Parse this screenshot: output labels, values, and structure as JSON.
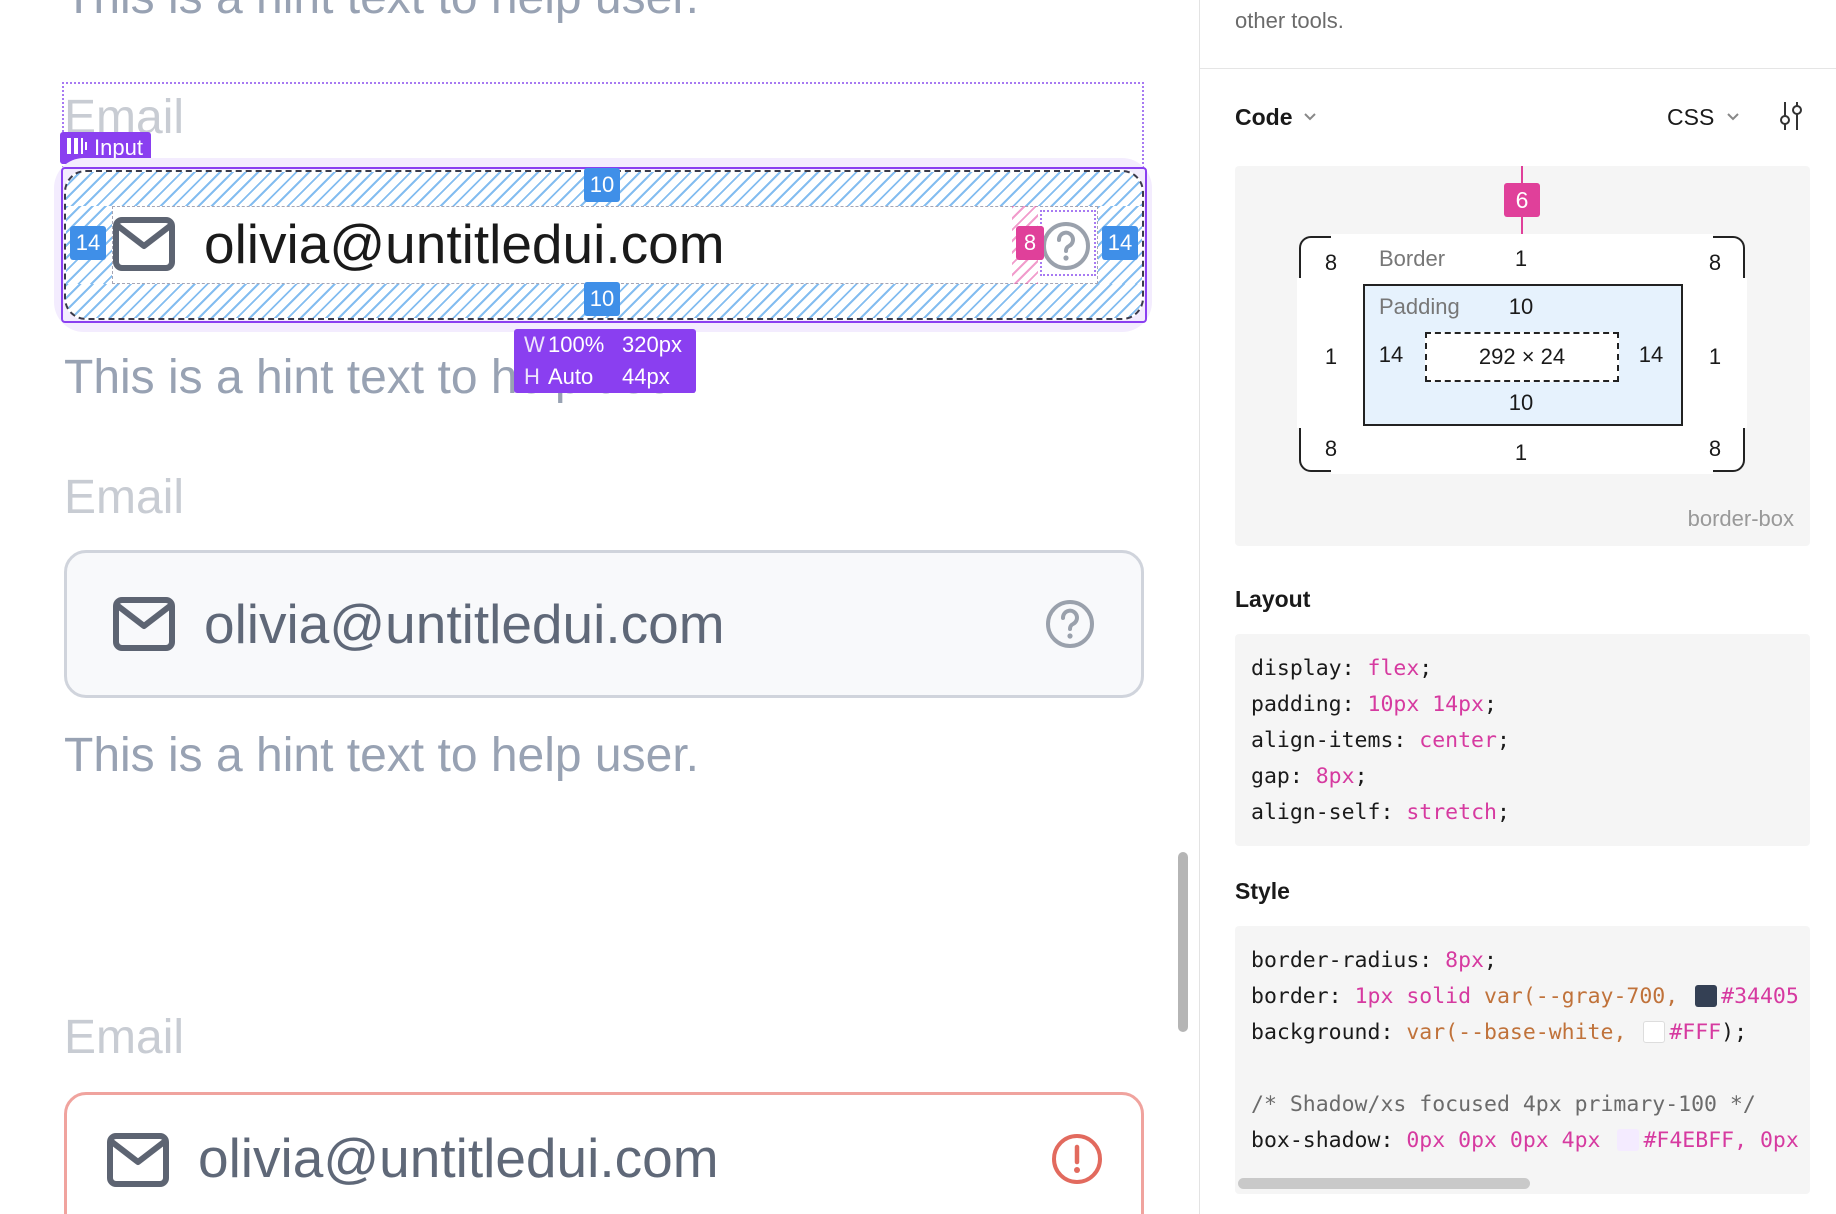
{
  "canvas": {
    "hint_top": "This is a hint text to help user.",
    "label_email": "Email",
    "component_tag": "Input",
    "selected_field": {
      "value": "olivia@untitledui.com",
      "padding_top": "10",
      "padding_bottom": "10",
      "padding_left": "14",
      "padding_right": "14",
      "gap": "8"
    },
    "size_tooltip": {
      "w_key": "W",
      "w_mode": "100%",
      "w_value": "320px",
      "h_key": "H",
      "h_mode": "Auto",
      "h_value": "44px"
    },
    "hint_selected": "This is a hint text to help user.",
    "field2": {
      "label": "Email",
      "value": "olivia@untitledui.com",
      "hint": "This is a hint text to help user."
    },
    "field3": {
      "label": "Email",
      "value": "olivia@untitledui.com"
    }
  },
  "panel": {
    "top_text": "other tools.",
    "code_section": {
      "title": "Code",
      "language": "CSS"
    },
    "box_model": {
      "margin_top": "6",
      "border_label": "Border",
      "border_top": "1",
      "border_bottom": "1",
      "border_left": "1",
      "border_right": "1",
      "radius_tl": "8",
      "radius_tr": "8",
      "radius_bl": "8",
      "radius_br": "8",
      "padding_label": "Padding",
      "padding_top": "10",
      "padding_bottom": "10",
      "padding_left": "14",
      "padding_right": "14",
      "content_size": "292 × 24",
      "box_sizing": "border-box"
    },
    "layout_title": "Layout",
    "layout_css": [
      {
        "prop": "display",
        "value": "flex"
      },
      {
        "prop": "padding",
        "value": "10px 14px"
      },
      {
        "prop": "align-items",
        "value": "center"
      },
      {
        "prop": "gap",
        "value": "8px"
      },
      {
        "prop": "align-self",
        "value": "stretch"
      }
    ],
    "style_title": "Style",
    "style_css": {
      "radius_prop": "border-radius",
      "radius_value": "8px",
      "border_prop": "border",
      "border_value": "1px solid",
      "border_var": "var(--gray-700,",
      "border_hex": "#34405",
      "bg_prop": "background",
      "bg_var": "var(--base-white,",
      "bg_hex": "#FFF",
      "bg_close": ");",
      "comment": "/* Shadow/xs focused 4px primary-100 */",
      "shadow_prop": "box-shadow",
      "shadow_value": "0px 0px 0px 4px",
      "shadow_hex": "#F4EBFF",
      "shadow_tail": ", 0px"
    }
  },
  "colors": {
    "accent_purple": "#8a3ff0",
    "measure_blue": "#3f8fe8",
    "measure_pink": "#e0409a",
    "gray_700": "#344054",
    "error_red": "#e57373",
    "swatch_gray": "#344054",
    "swatch_white": "#FFFFFF",
    "swatch_lavender": "#F4EBFF"
  },
  "icons": {
    "mail": "mail-icon",
    "help": "help-circle-icon",
    "alert": "alert-circle-icon",
    "chevron": "chevron-down-icon",
    "settings": "sliders-icon",
    "component": "component-icon"
  }
}
